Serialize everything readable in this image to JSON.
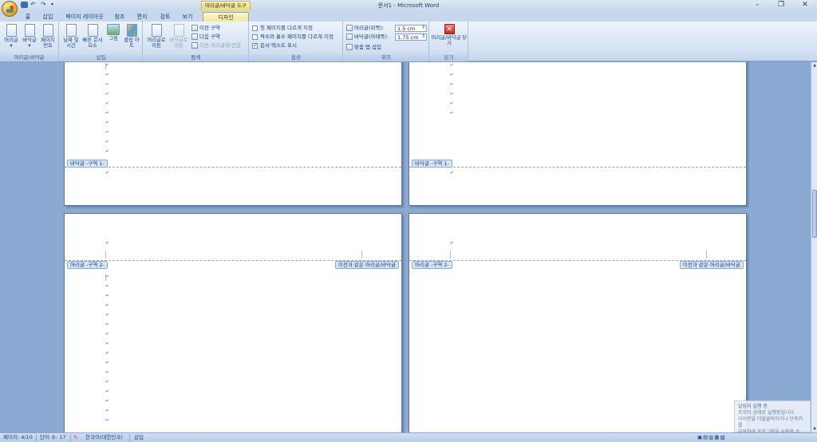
{
  "titlebar": {
    "title": "문서1 - Microsoft Word",
    "context_tool": "머리글/바닥글 도구",
    "controls": [
      "minimize-icon",
      "restore-icon",
      "close-icon"
    ]
  },
  "tabs": [
    "홈",
    "삽입",
    "페이지 레이아웃",
    "참조",
    "편지",
    "검토",
    "보기",
    "디자인"
  ],
  "active_tab": "디자인",
  "ribbon": {
    "group_header_footer": {
      "label": "머리글/바닥글",
      "buttons": [
        "머리글",
        "바닥글",
        "페이지 번호"
      ]
    },
    "group_insert": {
      "label": "삽입",
      "buttons": [
        "날짜 및 시간",
        "빠른 문서 요소",
        "그림",
        "클립 아트"
      ]
    },
    "group_nav": {
      "label": "탐색",
      "big_buttons": [
        "머리글로 이동",
        "바닥글로 이동"
      ],
      "small_buttons": [
        "이전 구역",
        "다음 구역",
        "이전 머리글에 연결"
      ]
    },
    "group_options": {
      "label": "옵션",
      "checkboxes": [
        {
          "label": "첫 페이지를 다르게 지정",
          "checked": false
        },
        {
          "label": "짝수와 홀수 페이지를 다르게 지정",
          "checked": false
        },
        {
          "label": "문서 텍스트 표시",
          "checked": true
        }
      ]
    },
    "group_position": {
      "label": "위치",
      "header_label": "머리글(위쪽):",
      "header_value": "1.5 cm",
      "footer_label": "바닥글(아래쪽):",
      "footer_value": "1.75 cm",
      "align_tab": "맞춤 탭 삽입"
    },
    "group_close": {
      "label": "닫기",
      "button": "머리글/바닥글 닫기"
    }
  },
  "document": {
    "para_mark": "↵",
    "footer_label_1": "바닥글 -구역 1-",
    "header_label_2": "머리글 -구역 2-",
    "same_as_previous": "이전과 같은 머리글/바닥글"
  },
  "status": {
    "page": "페이지: 4/10",
    "words": "단어 수: 17",
    "language": "한국어(대한민국)",
    "mode": "삽입"
  },
  "notification": {
    "title": "알림처 실행 중",
    "line1": "프로이 상태로 실행중입니다.",
    "line2": "아이콘을 더블클릭하거나 단축키를",
    "line3": "이용하여 프로그램을 사용할 수 있..."
  }
}
